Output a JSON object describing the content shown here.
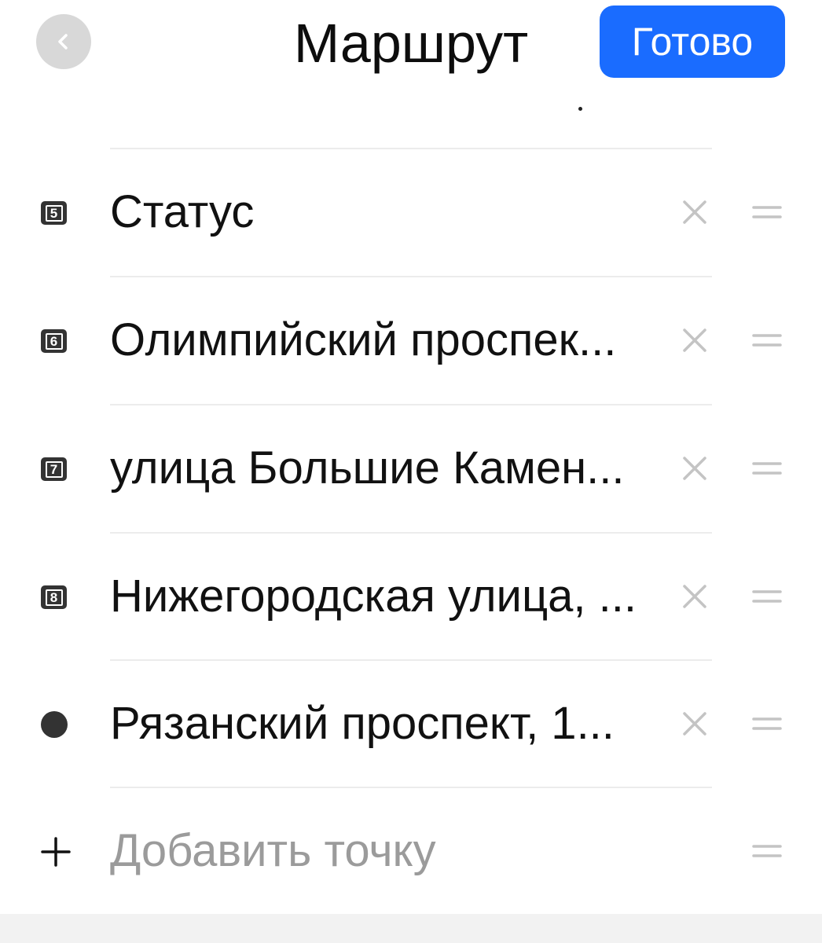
{
  "header": {
    "title": "Маршрут",
    "done_label": "Готово",
    "back_icon": "chevron-left-icon"
  },
  "route": {
    "points": [
      {
        "marker": "5",
        "marker_type": "numbered",
        "label": "Статус"
      },
      {
        "marker": "6",
        "marker_type": "numbered",
        "label": "Олимпийский проспек..."
      },
      {
        "marker": "7",
        "marker_type": "numbered",
        "label": "улица Большие Камен..."
      },
      {
        "marker": "8",
        "marker_type": "numbered",
        "label": "Нижегородская улица, ..."
      },
      {
        "marker": "",
        "marker_type": "dot",
        "label": "Рязанский проспект, 1..."
      }
    ],
    "add_point_label": "Добавить точку"
  },
  "icons": {
    "remove": "close-icon",
    "reorder": "drag-handle-icon",
    "add": "plus-icon"
  },
  "colors": {
    "accent": "#1a6cff",
    "marker": "#333333",
    "muted": "#c4c4c4",
    "placeholder": "#9b9b9b",
    "divider": "#ececec"
  }
}
